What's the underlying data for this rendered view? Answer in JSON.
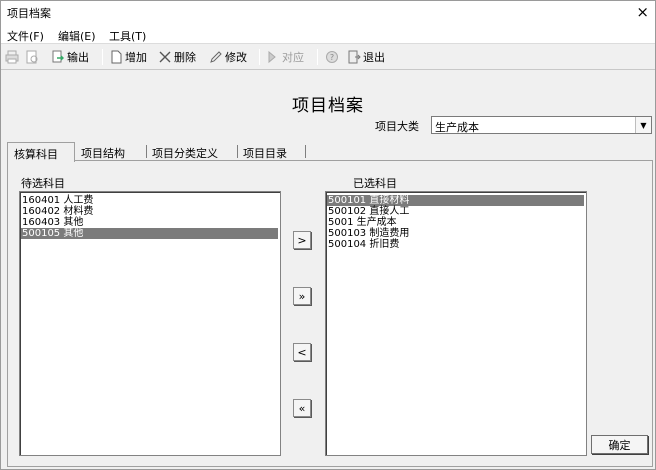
{
  "window": {
    "title": "项目档案",
    "close_glyph": "×"
  },
  "menu": [
    {
      "label": "文件(F)"
    },
    {
      "label": "编辑(E)"
    },
    {
      "label": "工具(T)"
    }
  ],
  "toolbar": {
    "output": "输出",
    "add": "增加",
    "delete": "删除",
    "modify": "修改",
    "match": "对应",
    "exit": "退出"
  },
  "heading": "项目档案",
  "category": {
    "label": "项目大类",
    "value": "生产成本",
    "arrow": "▼"
  },
  "tabs": [
    {
      "label": "核算科目",
      "active": true
    },
    {
      "label": "项目结构",
      "active": false
    },
    {
      "label": "项目分类定义",
      "active": false
    },
    {
      "label": "项目目录",
      "active": false
    }
  ],
  "candidate": {
    "label": "待选科目",
    "items": [
      {
        "text": "160401 人工费",
        "selected": false
      },
      {
        "text": "160402 材料费",
        "selected": false
      },
      {
        "text": "160403 其他",
        "selected": false
      },
      {
        "text": "500105 其他",
        "selected": true
      }
    ]
  },
  "chosen": {
    "label": "已选科目",
    "items": [
      {
        "text": "500101 直接材料",
        "selected": true
      },
      {
        "text": "500102 直接人工",
        "selected": false
      },
      {
        "text": "5001 生产成本",
        "selected": false
      },
      {
        "text": "500103 制造费用",
        "selected": false
      },
      {
        "text": "500104 折旧费",
        "selected": false
      }
    ]
  },
  "move_buttons": {
    "add_one": ">",
    "add_all": "»",
    "remove_one": "<",
    "remove_all": "«"
  },
  "ok_button": "确定",
  "icons": {
    "print": "printer-icon",
    "preview": "preview-icon",
    "output": "export-icon",
    "add": "new-document-icon",
    "delete": "cross-icon",
    "modify": "edit-icon",
    "match": "link-icon",
    "help": "help-icon",
    "exit": "exit-door-icon"
  }
}
